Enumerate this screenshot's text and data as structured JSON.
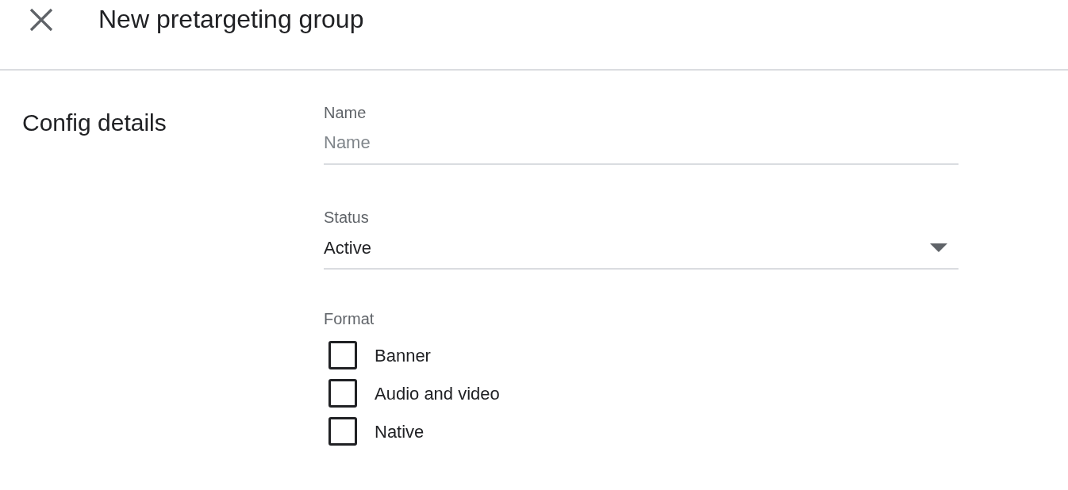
{
  "header": {
    "title": "New pretargeting group"
  },
  "section": {
    "title": "Config details"
  },
  "name_field": {
    "label": "Name",
    "placeholder": "Name"
  },
  "status_field": {
    "label": "Status",
    "value": "Active"
  },
  "format": {
    "label": "Format",
    "options": [
      {
        "label": "Banner",
        "checked": false
      },
      {
        "label": "Audio and video",
        "checked": false
      },
      {
        "label": "Native",
        "checked": false
      }
    ]
  }
}
